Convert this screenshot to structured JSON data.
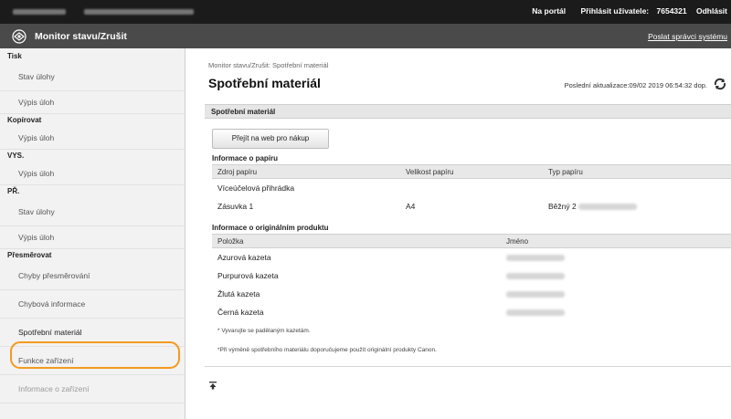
{
  "topbar": {
    "portal_link": "Na portál",
    "logged_user_label": "Přihlásit uživatele:",
    "user_id": "7654321",
    "logout": "Odhlásit"
  },
  "header": {
    "title": "Monitor stavu/Zrušit",
    "sysmgr_link": "Poslat správci systému"
  },
  "sidebar": {
    "sections": [
      {
        "label": "Tisk",
        "items": [
          "Stav úlohy",
          "Výpis úloh"
        ]
      },
      {
        "label": "Kopírovat",
        "items": [
          "Výpis úloh"
        ]
      },
      {
        "label": "VYS.",
        "items": [
          "Výpis úloh"
        ]
      },
      {
        "label": "PŘ.",
        "items": [
          "Stav úlohy",
          "Výpis úloh"
        ]
      },
      {
        "label": "Přesměrovat",
        "items": [
          "Chyby přesměrování"
        ]
      }
    ],
    "extra_items": [
      "Chybová informace",
      "Spotřební materiál",
      "Funkce zařízení",
      "Informace o zařízení"
    ]
  },
  "main": {
    "breadcrumb": "Monitor stavu/Zrušit: Spotřební materiál",
    "title": "Spotřební materiál",
    "updated": "Poslední aktualizace:09/02 2019 06:54:32 dop.",
    "section_title": "Spotřební materiál",
    "buy_button": "Přejít na web pro nákup",
    "paper_info": {
      "title": "Informace o papíru",
      "headers": [
        "Zdroj papíru",
        "Velikost papíru",
        "Typ papíru"
      ],
      "rows": [
        [
          "Víceúčelová přihrádka",
          "",
          ""
        ],
        [
          "Zásuvka 1",
          "A4",
          "Běžný 2"
        ]
      ]
    },
    "original_info": {
      "title": "Informace o originálním produktu",
      "headers": [
        "Položka",
        "Jméno"
      ],
      "rows": [
        "Azurová kazeta",
        "Purpurová kazeta",
        "Žlutá kazeta",
        "Černá kazeta"
      ]
    },
    "note1": "* Vyvarujte se padělaným kazetám.",
    "note2": "*Při výměně spotřebního materiálu doporučujeme použít originální produkty Canon."
  },
  "colors": {
    "highlight": "#f39a1e",
    "topbar": "#1b1b1b",
    "titlebar": "#4a4a4a"
  }
}
